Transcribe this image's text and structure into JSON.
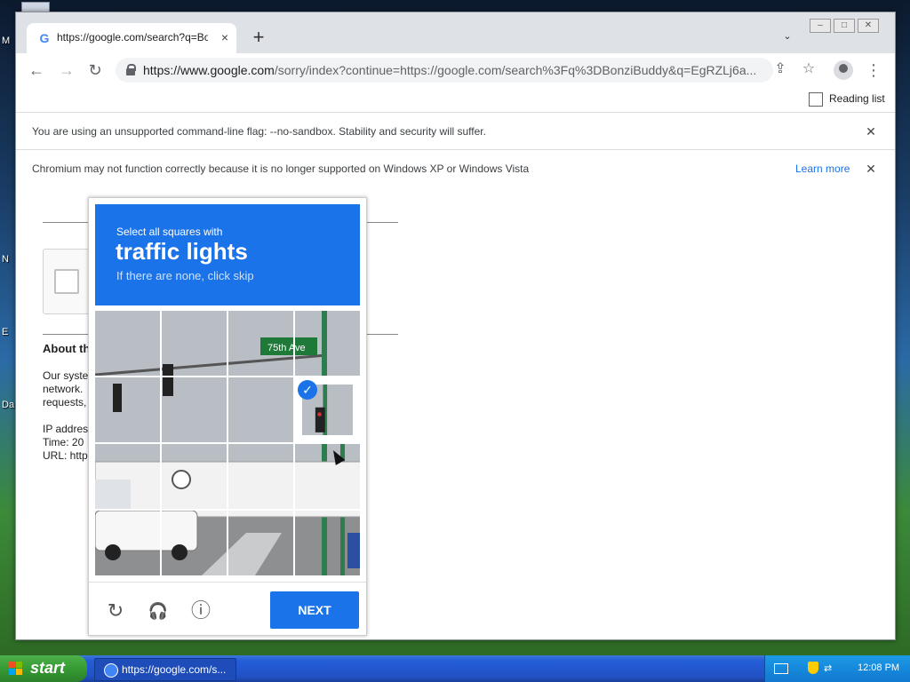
{
  "desktop": {
    "labels": [
      "M",
      "N",
      "E",
      "Da"
    ]
  },
  "window": {
    "tab": {
      "title": "https://google.com/search?q=Bonzi",
      "close": "×"
    },
    "new_tab": "+",
    "tab_search": "⌄",
    "controls": {
      "minimize": "–",
      "maximize": "□",
      "close": "✕"
    }
  },
  "toolbar": {
    "back": "←",
    "forward": "→",
    "reload": "↻",
    "url_domain": "https://www.google.com",
    "url_rest": "/sorry/index?continue=https://google.com/search%3Fq%3DBonziBuddy&q=EgRZLj6a...",
    "share": "⇪",
    "star": "☆",
    "menu": "⋮"
  },
  "bookmarks": {
    "reading_list": "Reading list"
  },
  "infobars": [
    {
      "message": "You are using an unsupported command-line flag: --no-sandbox. Stability and security will suffer.",
      "close": "✕"
    },
    {
      "message": "Chromium may not function correctly because it is no longer supported on Windows XP or Windows Vista",
      "link": "Learn more",
      "close": "✕"
    }
  ],
  "page": {
    "about_heading": "About th",
    "body_lines": [
      "Our syste",
      "network.",
      "requests,"
    ],
    "ip_line": "IP addres",
    "time_line": "Time: 20",
    "url_line": "URL: http"
  },
  "captcha": {
    "select_all": "Select all squares with",
    "target": "traffic lights",
    "skip_hint": "If there are none, click skip",
    "grid_rows": 4,
    "grid_cols": 4,
    "selected_tiles": [
      7
    ],
    "street_sign": "75th Ave",
    "next_label": "NEXT",
    "reload_icon": "↻",
    "audio_icon": "🎧",
    "info_icon": "ⓘ"
  },
  "taskbar": {
    "start_label": "start",
    "task_label": "https://google.com/s...",
    "clock": "12:08 PM"
  },
  "colors": {
    "accent": "#1a73e8",
    "taskbar": "#245ed8",
    "start": "#379b34"
  }
}
